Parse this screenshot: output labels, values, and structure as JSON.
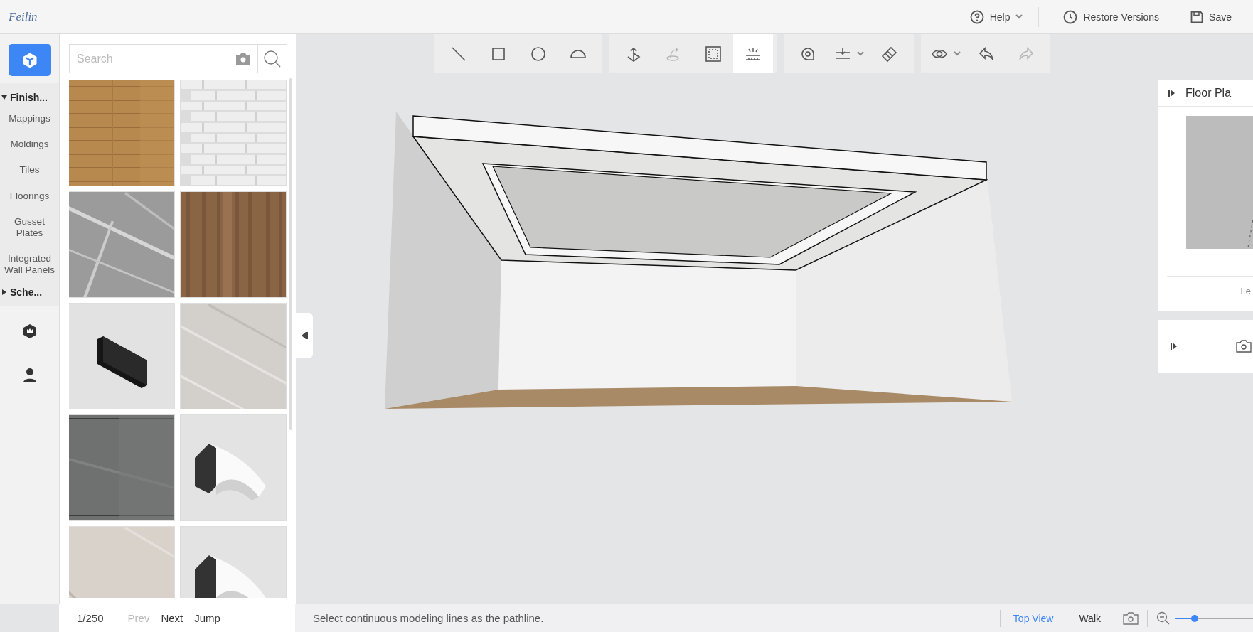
{
  "header": {
    "logo": "Feilin",
    "actions": [
      {
        "label": "Help",
        "dropdown": true
      },
      {
        "label": "Restore Versions",
        "dropdown": false
      },
      {
        "label": "Save",
        "dropdown": false
      }
    ]
  },
  "rail": {
    "top_button": {
      "selected": true
    },
    "sections": [
      {
        "label": "Finish...",
        "expanded": true,
        "items": [
          "Mappings",
          "Moldings",
          "Tiles",
          "Floorings",
          "Gusset Plates",
          "Integrated Wall Panels"
        ]
      },
      {
        "label": "Sche...",
        "expanded": false
      }
    ]
  },
  "library": {
    "search": {
      "placeholder": "Search"
    },
    "pagination": {
      "page": "1/250",
      "prev": {
        "label": "Prev",
        "disabled": true
      },
      "next": {
        "label": "Next",
        "disabled": false
      },
      "jump": "Jump"
    }
  },
  "toolbar": {
    "groups": [
      {
        "tools": [
          {
            "selected": false,
            "disabled": false,
            "dropdown": false
          },
          {
            "selected": false,
            "disabled": false,
            "dropdown": false
          },
          {
            "selected": false,
            "disabled": false,
            "dropdown": false
          },
          {
            "selected": false,
            "disabled": false,
            "dropdown": false
          }
        ]
      },
      {
        "tools": [
          {
            "selected": false,
            "disabled": false,
            "dropdown": false
          },
          {
            "selected": false,
            "disabled": true,
            "dropdown": false
          },
          {
            "selected": false,
            "disabled": false,
            "dropdown": false
          },
          {
            "selected": true,
            "disabled": false,
            "dropdown": false
          }
        ]
      },
      {
        "tools": [
          {
            "selected": false,
            "disabled": false,
            "dropdown": false
          },
          {
            "selected": false,
            "disabled": false,
            "dropdown": true
          },
          {
            "selected": false,
            "disabled": false,
            "dropdown": false
          }
        ]
      },
      {
        "tools": [
          {
            "selected": false,
            "disabled": false,
            "dropdown": true
          },
          {
            "selected": false,
            "disabled": false,
            "dropdown": false
          },
          {
            "selected": false,
            "disabled": true,
            "dropdown": false
          }
        ]
      }
    ]
  },
  "floor_plan_panel": {
    "title": "Floor Pla",
    "footer": "Le"
  },
  "status_bar": {
    "message": "Select continuous modeling lines as the pathline.",
    "views": [
      {
        "label": "Top View",
        "selected": true
      },
      {
        "label": "Walk",
        "selected": false
      }
    ],
    "zoom": {
      "level": 0.25
    }
  }
}
